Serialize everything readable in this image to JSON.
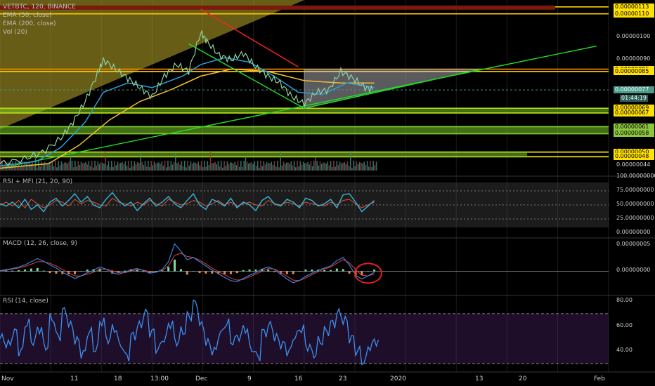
{
  "chart_data": [
    {
      "type": "line",
      "title": "VETBTC, 120, BINANCE",
      "legend": [
        "EMA (50, close)",
        "EMA (200, close)",
        "Vol (20)"
      ],
      "x_ticks": [
        "Nov",
        "11",
        "18",
        "13:00",
        "Dec",
        "9",
        "16",
        "23",
        "2020",
        "13",
        "20",
        "Feb"
      ],
      "y_ticks": [
        "0.00000100",
        "0.00000090",
        "0.00000044"
      ],
      "price_tags_yellow": [
        "0.00000113",
        "0.00000110",
        "0.00000086",
        "0.00000085",
        "0.00000069",
        "0.00000067",
        "0.00000050",
        "0.00000048"
      ],
      "price_tags_green": [
        "0.00000061",
        "0.00000058"
      ],
      "current_price": "0.00000077",
      "countdown": "01:44:19",
      "ylim": [
        4.2e-07,
        1.16e-06
      ],
      "horizontal_levels": [
        {
          "price": 1.13e-06,
          "color": "#ffcc00"
        },
        {
          "price": 1.1e-06,
          "color": "#ffcc00"
        },
        {
          "price": 8.6e-07,
          "color": "#ff8c00"
        },
        {
          "price": 8.5e-07,
          "color": "#ffcc00"
        },
        {
          "price": 6.9e-07,
          "color": "#ffee00"
        },
        {
          "price": 6.7e-07,
          "color": "#ffee00"
        },
        {
          "price": 6.1e-07,
          "color": "#8cc63f"
        },
        {
          "price": 5.8e-07,
          "color": "#8cc63f"
        },
        {
          "price": 5e-07,
          "color": "#ffee00"
        },
        {
          "price": 4.8e-07,
          "color": "#ffee00"
        }
      ],
      "price_series": [
        {
          "x": 0,
          "y": 4.5e-07
        },
        {
          "x": 4,
          "y": 4.7e-07
        },
        {
          "x": 7,
          "y": 5e-07
        },
        {
          "x": 10,
          "y": 5.6e-07
        },
        {
          "x": 12,
          "y": 6.3e-07
        },
        {
          "x": 14,
          "y": 7.2e-07
        },
        {
          "x": 16,
          "y": 8.4e-07
        },
        {
          "x": 17,
          "y": 9e-07
        },
        {
          "x": 19,
          "y": 8.6e-07
        },
        {
          "x": 21,
          "y": 8.2e-07
        },
        {
          "x": 23,
          "y": 7.8e-07
        },
        {
          "x": 25,
          "y": 7.4e-07
        },
        {
          "x": 27,
          "y": 8.3e-07
        },
        {
          "x": 29,
          "y": 8.8e-07
        },
        {
          "x": 31,
          "y": 8.5e-07
        },
        {
          "x": 33,
          "y": 1.02e-06
        },
        {
          "x": 34,
          "y": 9.8e-07
        },
        {
          "x": 36,
          "y": 9.2e-07
        },
        {
          "x": 38,
          "y": 9e-07
        },
        {
          "x": 40,
          "y": 9.3e-07
        },
        {
          "x": 42,
          "y": 8.7e-07
        },
        {
          "x": 44,
          "y": 8.3e-07
        },
        {
          "x": 46,
          "y": 8e-07
        },
        {
          "x": 48,
          "y": 7.4e-07
        },
        {
          "x": 50,
          "y": 7.1e-07
        },
        {
          "x": 52,
          "y": 7.6e-07
        },
        {
          "x": 54,
          "y": 7.7e-07
        },
        {
          "x": 56,
          "y": 8.5e-07
        },
        {
          "x": 58,
          "y": 8.2e-07
        },
        {
          "x": 60,
          "y": 7.8e-07
        },
        {
          "x": 61.5,
          "y": 7.7e-07
        }
      ],
      "ema50": [
        {
          "x": 0,
          "y": 4.4e-07
        },
        {
          "x": 6,
          "y": 4.6e-07
        },
        {
          "x": 10,
          "y": 5.2e-07
        },
        {
          "x": 14,
          "y": 6.3e-07
        },
        {
          "x": 17,
          "y": 7.6e-07
        },
        {
          "x": 21,
          "y": 8e-07
        },
        {
          "x": 25,
          "y": 7.8e-07
        },
        {
          "x": 30,
          "y": 8.3e-07
        },
        {
          "x": 33,
          "y": 8.8e-07
        },
        {
          "x": 37,
          "y": 9.1e-07
        },
        {
          "x": 41,
          "y": 8.9e-07
        },
        {
          "x": 45,
          "y": 8.3e-07
        },
        {
          "x": 49,
          "y": 7.6e-07
        },
        {
          "x": 53,
          "y": 7.5e-07
        },
        {
          "x": 57,
          "y": 8e-07
        },
        {
          "x": 61.5,
          "y": 7.8e-07
        }
      ],
      "ema200": [
        {
          "x": 0,
          "y": 4.3e-07
        },
        {
          "x": 8,
          "y": 4.5e-07
        },
        {
          "x": 13,
          "y": 5.3e-07
        },
        {
          "x": 18,
          "y": 6.4e-07
        },
        {
          "x": 23,
          "y": 7.2e-07
        },
        {
          "x": 28,
          "y": 7.7e-07
        },
        {
          "x": 33,
          "y": 8.3e-07
        },
        {
          "x": 38,
          "y": 8.6e-07
        },
        {
          "x": 44,
          "y": 8.5e-07
        },
        {
          "x": 50,
          "y": 8.1e-07
        },
        {
          "x": 56,
          "y": 8e-07
        },
        {
          "x": 61.5,
          "y": 8e-07
        }
      ],
      "trendlines": [
        {
          "x1": 33,
          "y1": 1.12e-06,
          "x2": 49,
          "y2": 8.7e-07,
          "color": "#ff2020"
        },
        {
          "x1": 31,
          "y1": 9.7e-07,
          "x2": 50,
          "y2": 6.9e-07,
          "color": "#22dd22"
        },
        {
          "x1": 50,
          "y1": 6.9e-07,
          "x2": 79,
          "y2": 8.6e-07,
          "color": "#22dd22"
        },
        {
          "x1": 0,
          "y1": 4.3e-07,
          "x2": 98,
          "y2": 9.6e-07,
          "color": "#22dd22"
        }
      ],
      "triangle": [
        {
          "x": 50,
          "y": 8.6e-07
        },
        {
          "x": 79,
          "y": 8.6e-07
        },
        {
          "x": 50,
          "y": 6.9e-07
        }
      ],
      "upper_wedge": [
        {
          "x": 0,
          "y": 6e-07
        },
        {
          "x": 50,
          "y": 1.16e-06
        }
      ]
    },
    {
      "type": "line",
      "title": "RSI + MFI (21, 20, 90)",
      "y_ticks": [
        "100.00000000",
        "75.00000000",
        "50.00000000",
        "25.00000000",
        "0.00000000"
      ],
      "ylim": [
        0,
        100
      ],
      "rsi": [
        52,
        48,
        55,
        45,
        60,
        42,
        50,
        38,
        55,
        62,
        48,
        58,
        70,
        55,
        65,
        50,
        45,
        60,
        72,
        58,
        48,
        55,
        40,
        52,
        62,
        48,
        55,
        65,
        52,
        45,
        58,
        70,
        50,
        42,
        60,
        55,
        48,
        62,
        45,
        55,
        50,
        40,
        58,
        65,
        52,
        48,
        60,
        55,
        45,
        62,
        58,
        48,
        52,
        60,
        45,
        68,
        70,
        55,
        38,
        48,
        58
      ],
      "mfi": [
        50,
        55,
        48,
        58,
        45,
        60,
        52,
        45,
        50,
        58,
        55,
        48,
        60,
        52,
        58,
        55,
        50,
        48,
        62,
        55,
        52,
        48,
        55,
        50,
        58,
        52,
        48,
        60,
        55,
        50,
        52,
        58,
        55,
        48,
        52,
        58,
        50,
        55,
        48,
        52,
        55,
        50,
        48,
        58,
        52,
        50,
        55,
        52,
        48,
        55,
        52,
        50,
        48,
        55,
        50,
        58,
        60,
        52,
        45,
        50,
        55
      ]
    },
    {
      "type": "line",
      "title": "MACD (12, 26, close, 9)",
      "y_ticks": [
        "0.00000005",
        "0.00000000"
      ],
      "ylim": [
        -4.5e-09,
        6.2e-09
      ],
      "macd": [
        0.1,
        0.3,
        0.5,
        0.8,
        1.2,
        1.8,
        2.4,
        1.9,
        1.2,
        0.6,
        -0.2,
        -0.8,
        -1.4,
        -0.9,
        -0.3,
        0.2,
        0.8,
        0.4,
        -0.3,
        -0.6,
        -0.2,
        0.3,
        0.5,
        0.1,
        -0.4,
        -0.2,
        0.3,
        1.8,
        5.2,
        3.8,
        2.2,
        2.6,
        1.8,
        1.0,
        0.2,
        -0.5,
        -1.2,
        -1.8,
        -2.0,
        -1.4,
        -0.8,
        -0.3,
        0.4,
        0.8,
        0.3,
        -0.6,
        -1.5,
        -2.2,
        -1.8,
        -1.0,
        -0.4,
        0.2,
        0.6,
        1.0,
        2.0,
        2.6,
        1.2,
        -0.8,
        -1.5,
        -0.9,
        -0.2
      ],
      "signal": [
        0.0,
        0.2,
        0.4,
        0.6,
        0.9,
        1.3,
        1.8,
        1.8,
        1.5,
        1.0,
        0.3,
        -0.3,
        -0.9,
        -0.9,
        -0.6,
        -0.2,
        0.3,
        0.4,
        0.1,
        -0.3,
        -0.3,
        0.0,
        0.3,
        0.2,
        -0.1,
        -0.2,
        0.1,
        1.0,
        3.0,
        3.4,
        2.8,
        2.6,
        2.1,
        1.4,
        0.6,
        -0.1,
        -0.7,
        -1.3,
        -1.7,
        -1.6,
        -1.1,
        -0.6,
        0.0,
        0.5,
        0.4,
        -0.2,
        -1.0,
        -1.7,
        -1.8,
        -1.3,
        -0.7,
        -0.1,
        0.4,
        0.8,
        1.5,
        2.2,
        1.6,
        0.3,
        -0.8,
        -0.9,
        -0.5
      ],
      "annotation": "red circle around latest crossover"
    },
    {
      "type": "line",
      "title": "RSI (14, close)",
      "y_ticks": [
        "80.00",
        "60.00",
        "40.00"
      ],
      "ylim": [
        25,
        84
      ],
      "bands": [
        70,
        30
      ],
      "values": [
        50,
        45,
        55,
        40,
        62,
        48,
        58,
        44,
        66,
        52,
        72,
        60,
        48,
        38,
        55,
        42,
        64,
        50,
        58,
        45,
        36,
        52,
        60,
        70,
        55,
        42,
        50,
        62,
        48,
        56,
        68,
        78,
        60,
        46,
        40,
        54,
        62,
        48,
        52,
        58,
        42,
        36,
        55,
        60,
        50,
        45,
        40,
        52,
        58,
        44,
        38,
        48,
        56,
        62,
        70,
        64,
        50,
        40,
        32,
        44,
        48
      ]
    }
  ]
}
